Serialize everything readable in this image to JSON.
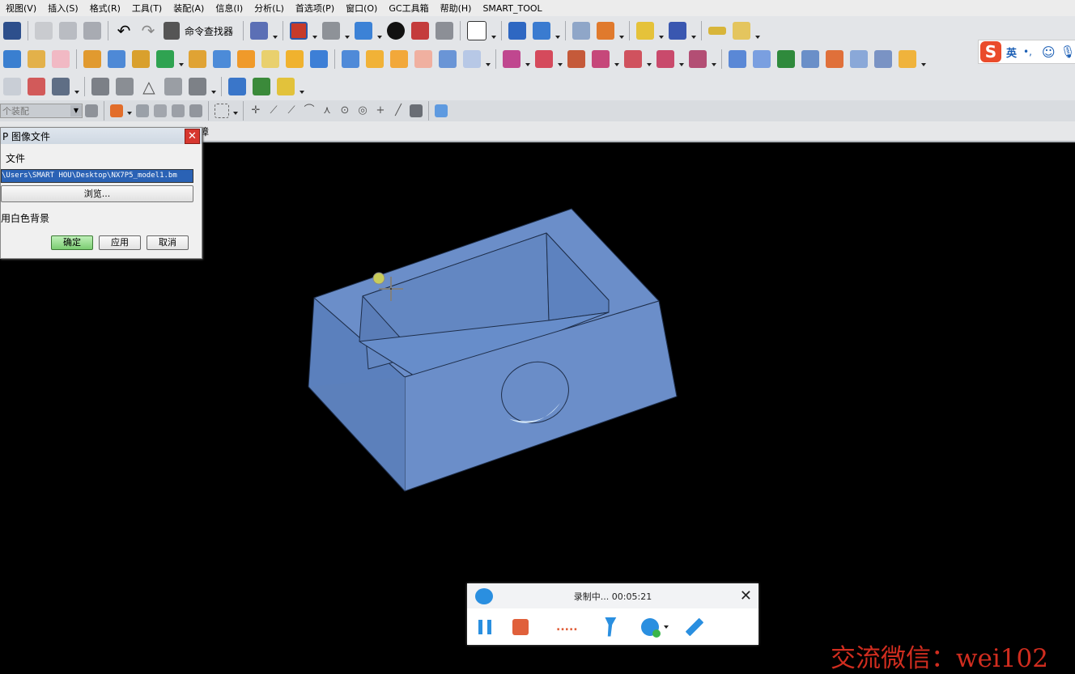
{
  "menu": [
    "视图(V)",
    "插入(S)",
    "格式(R)",
    "工具(T)",
    "装配(A)",
    "信息(I)",
    "分析(L)",
    "首选项(P)",
    "窗口(O)",
    "GC工具箱",
    "帮助(H)",
    "SMART_TOOL"
  ],
  "toolbar": {
    "command_finder_label": "命令查找器"
  },
  "selection_bar": {
    "filter_value": "个装配"
  },
  "tab_fragment": "障",
  "dialog": {
    "title": "P 图像文件",
    "file_label": "文件",
    "file_path": "\\Users\\SMART HOU\\Desktop\\NX7P5_model1.bm",
    "browse_label": "浏览...",
    "white_bg_label": "用白色背景",
    "ok_label": "确定",
    "apply_label": "应用",
    "cancel_label": "取消"
  },
  "ime": {
    "mode": "英",
    "punct": "•,"
  },
  "recorder": {
    "status": "录制中... 00:05:21",
    "dots": "....."
  },
  "watermark": "交流微信：wei102",
  "colors": {
    "model_fill": "#6b8ec9",
    "model_dark": "#5a7db8",
    "model_edge": "#1e2e4a",
    "recorder_stop": "#e0603b",
    "watermark": "#d12d1f"
  }
}
